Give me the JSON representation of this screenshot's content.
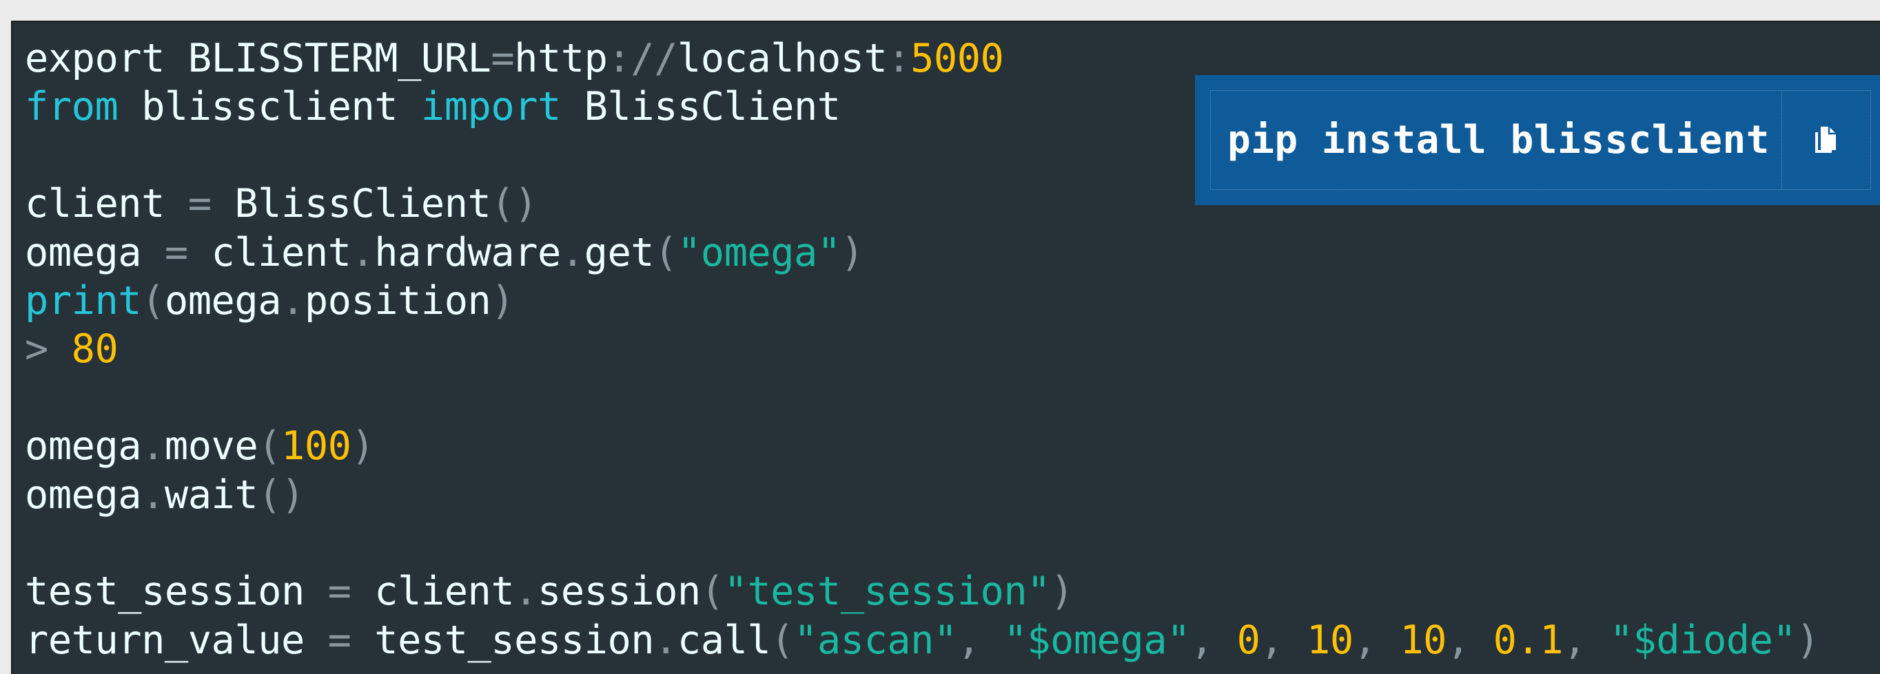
{
  "colors": {
    "page_background": "#ececec",
    "code_background": "#263238",
    "plain": "#eeffff",
    "keyword": "#26c6da",
    "punctuation": "#89969e",
    "string": "#1ab8a0",
    "number": "#ffc107",
    "install_background": "#0f5b99"
  },
  "install": {
    "command": "pip install blissclient",
    "copy_icon": "copy-icon"
  },
  "code": {
    "lines": [
      [
        [
          "export BLISSTERM_URL",
          "plain"
        ],
        [
          "=",
          "punc"
        ],
        [
          "http",
          "plain"
        ],
        [
          ":",
          "punc"
        ],
        [
          "//",
          "punc"
        ],
        [
          "localhost",
          "plain"
        ],
        [
          ":",
          "punc"
        ],
        [
          "5000",
          "num"
        ]
      ],
      [
        [
          "from",
          "kw"
        ],
        [
          " blissclient ",
          "plain"
        ],
        [
          "import",
          "kw"
        ],
        [
          " BlissClient",
          "plain"
        ]
      ],
      [],
      [
        [
          "client ",
          "plain"
        ],
        [
          "=",
          "punc"
        ],
        [
          " BlissClient",
          "plain"
        ],
        [
          "()",
          "punc"
        ]
      ],
      [
        [
          "omega ",
          "plain"
        ],
        [
          "=",
          "punc"
        ],
        [
          " client",
          "plain"
        ],
        [
          ".",
          "punc"
        ],
        [
          "hardware",
          "plain"
        ],
        [
          ".",
          "punc"
        ],
        [
          "get",
          "plain"
        ],
        [
          "(",
          "punc"
        ],
        [
          "\"omega\"",
          "str"
        ],
        [
          ")",
          "punc"
        ]
      ],
      [
        [
          "print",
          "kw"
        ],
        [
          "(",
          "punc"
        ],
        [
          "omega",
          "plain"
        ],
        [
          ".",
          "punc"
        ],
        [
          "position",
          "plain"
        ],
        [
          ")",
          "punc"
        ]
      ],
      [
        [
          ">",
          "punc"
        ],
        [
          " ",
          "plain"
        ],
        [
          "80",
          "num"
        ]
      ],
      [],
      [
        [
          "omega",
          "plain"
        ],
        [
          ".",
          "punc"
        ],
        [
          "move",
          "plain"
        ],
        [
          "(",
          "punc"
        ],
        [
          "100",
          "num"
        ],
        [
          ")",
          "punc"
        ]
      ],
      [
        [
          "omega",
          "plain"
        ],
        [
          ".",
          "punc"
        ],
        [
          "wait",
          "plain"
        ],
        [
          "()",
          "punc"
        ]
      ],
      [],
      [
        [
          "test_session ",
          "plain"
        ],
        [
          "=",
          "punc"
        ],
        [
          " client",
          "plain"
        ],
        [
          ".",
          "punc"
        ],
        [
          "session",
          "plain"
        ],
        [
          "(",
          "punc"
        ],
        [
          "\"test_session\"",
          "str"
        ],
        [
          ")",
          "punc"
        ]
      ],
      [
        [
          "return_value ",
          "plain"
        ],
        [
          "=",
          "punc"
        ],
        [
          " test_session",
          "plain"
        ],
        [
          ".",
          "punc"
        ],
        [
          "call",
          "plain"
        ],
        [
          "(",
          "punc"
        ],
        [
          "\"ascan\"",
          "str"
        ],
        [
          ", ",
          "punc"
        ],
        [
          "\"$omega\"",
          "str"
        ],
        [
          ", ",
          "punc"
        ],
        [
          "0",
          "num"
        ],
        [
          ", ",
          "punc"
        ],
        [
          "10",
          "num"
        ],
        [
          ", ",
          "punc"
        ],
        [
          "10",
          "num"
        ],
        [
          ", ",
          "punc"
        ],
        [
          "0.1",
          "num"
        ],
        [
          ", ",
          "punc"
        ],
        [
          "\"$diode\"",
          "str"
        ],
        [
          ")",
          "punc"
        ]
      ]
    ]
  }
}
